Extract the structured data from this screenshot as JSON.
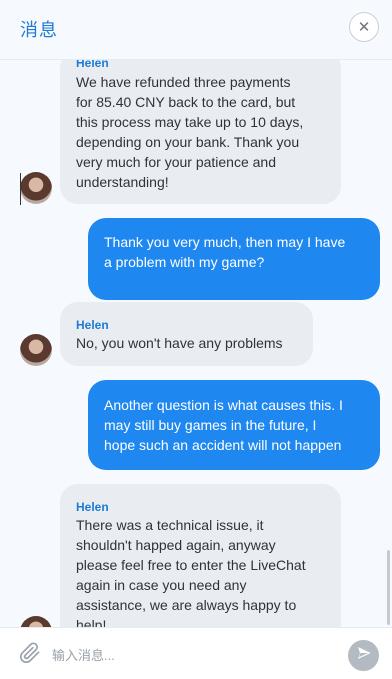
{
  "header": {
    "title": "消息",
    "close_icon": "close-icon",
    "close_glyph": "✕"
  },
  "messages": [
    {
      "direction": "in",
      "sender": "Helen",
      "lines": [
        "We have refunded three payments",
        "for 85.40 CNY back to the card, but",
        "this process may take up to 10 days,",
        "depending on your bank. Thank you",
        "very much for your patience and",
        "understanding!"
      ]
    },
    {
      "direction": "out",
      "lines": [
        "Thank you very much, then may I have",
        "a problem with my game?"
      ]
    },
    {
      "direction": "in",
      "sender": "Helen",
      "lines": [
        "No, you won't have any problems"
      ]
    },
    {
      "direction": "out",
      "lines": [
        "Another question is what causes this. I",
        "may still buy games in the future, I",
        "hope such an accident will not happen"
      ]
    },
    {
      "direction": "in",
      "sender": "Helen",
      "lines": [
        "There was a technical issue, it",
        "shouldn't happed again, anyway",
        "please feel free to enter the LiveChat",
        "again in case you need any",
        "assistance, we are always happy to",
        "help!"
      ]
    }
  ],
  "composer": {
    "placeholder": "输入消息...",
    "attach_icon": "paperclip-icon",
    "send_icon": "send-icon"
  },
  "colors": {
    "accent": "#1d7bd6",
    "outgoing_bubble": "#1e88f0",
    "incoming_bubble": "#e9edf2",
    "background": "#f6f9fd"
  }
}
